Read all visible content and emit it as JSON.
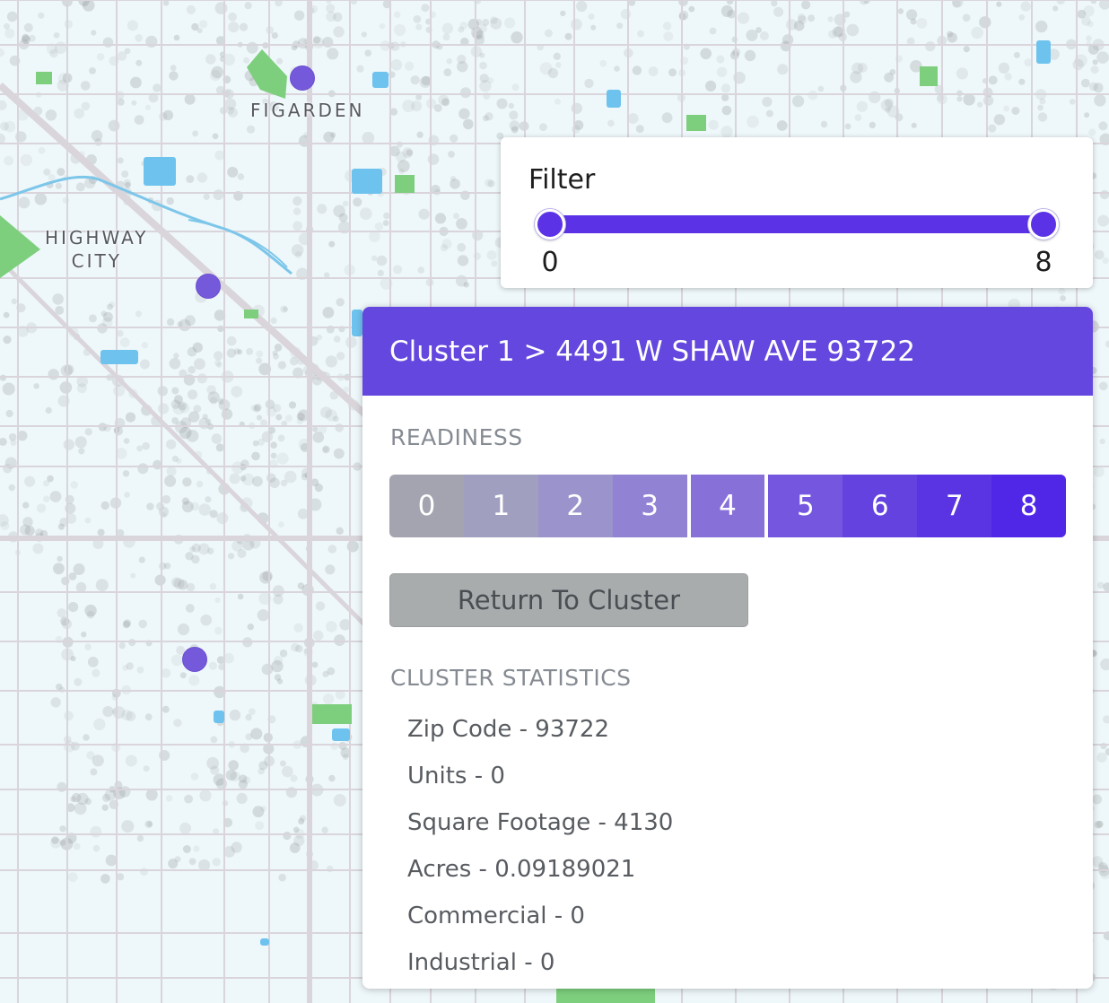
{
  "map": {
    "labels": {
      "figarden": "FIGARDEN",
      "highway_city_line1": "HIGHWAY",
      "highway_city_line2": "CITY"
    },
    "colors": {
      "background": "#eef7fa",
      "road": "#d9d5db",
      "building": "#9aa0a3",
      "park": "#7dcf7d",
      "water": "#6dc3ee",
      "cluster_marker": "#7559db"
    }
  },
  "filter": {
    "title": "Filter",
    "min_value": "0",
    "max_value": "8",
    "range_min": 0,
    "range_max": 8,
    "selected_low": 0,
    "selected_high": 8
  },
  "panel": {
    "header": "Cluster 1 > 4491 W SHAW AVE 93722",
    "readiness_title": "READINESS",
    "readiness": [
      {
        "label": "0",
        "color": "#a3a4af"
      },
      {
        "label": "1",
        "color": "#a19fbf"
      },
      {
        "label": "2",
        "color": "#9b93cb"
      },
      {
        "label": "3",
        "color": "#9282d3"
      },
      {
        "label": "4",
        "color": "#8870d9",
        "selected": true
      },
      {
        "label": "5",
        "color": "#7457de"
      },
      {
        "label": "6",
        "color": "#6442e0"
      },
      {
        "label": "7",
        "color": "#5a34e2"
      },
      {
        "label": "8",
        "color": "#5027e6"
      }
    ],
    "return_button": "Return To Cluster",
    "stats_title": "CLUSTER STATISTICS",
    "stats": [
      "Zip Code - 93722",
      "Units - 0",
      "Square Footage - 4130",
      "Acres - 0.09189021",
      "Commercial - 0",
      "Industrial - 0"
    ]
  }
}
